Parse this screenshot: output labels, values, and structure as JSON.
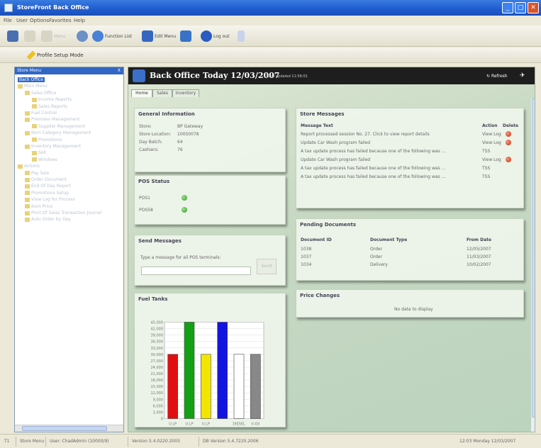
{
  "window": {
    "title": "StoreFront Back Office"
  },
  "menu": [
    "File",
    "User",
    "Options",
    "Favorites",
    "Help"
  ],
  "toolbar": {
    "buttons": [
      "Back",
      "Forward",
      "Menu",
      "Function List",
      "Edit Menu",
      "",
      "Log out",
      ""
    ]
  },
  "toolbar2": {
    "mode_label": "Profile Setup Mode"
  },
  "sidebar": {
    "header": "Store Menu",
    "close": "X",
    "items": [
      {
        "label": "Back Office",
        "level": 0,
        "selected": true
      },
      {
        "label": "Main Menu",
        "level": 0
      },
      {
        "label": "Sales Office",
        "level": 1
      },
      {
        "label": "Income Reports",
        "level": 2
      },
      {
        "label": "Sales Reports",
        "level": 2
      },
      {
        "label": "Fuel Control",
        "level": 1
      },
      {
        "label": "Premises Management",
        "level": 1
      },
      {
        "label": "Supplier Management",
        "level": 2
      },
      {
        "label": "Item Category Management",
        "level": 1
      },
      {
        "label": "Promotions",
        "level": 2
      },
      {
        "label": "Inventory Management",
        "level": 1
      },
      {
        "label": "Sell",
        "level": 2
      },
      {
        "label": "Windows",
        "level": 2
      },
      {
        "label": "Actions",
        "level": 0
      },
      {
        "label": "Pay Sale",
        "level": 1
      },
      {
        "label": "Order Document",
        "level": 1
      },
      {
        "label": "End Of Day Report",
        "level": 1
      },
      {
        "label": "Promotions Setup",
        "level": 1
      },
      {
        "label": "View Log for Process",
        "level": 1
      },
      {
        "label": "Item Price",
        "level": 1
      },
      {
        "label": "Print Of Sales Transaction Journal",
        "level": 1
      },
      {
        "label": "Auto Order by Day",
        "level": 1
      }
    ]
  },
  "main": {
    "title": "Back Office Today 12/03/2007",
    "last_updated": "Last updated 11:58:01",
    "refresh": "Refresh",
    "tabs": [
      {
        "label": "Home",
        "active": true
      },
      {
        "label": "Sales",
        "active": false
      },
      {
        "label": "Inventory",
        "active": false
      }
    ]
  },
  "general": {
    "title": "General Information",
    "rows": [
      {
        "label": "Store:",
        "value": "BP Gateway"
      },
      {
        "label": "Store Location:",
        "value": "10050078"
      },
      {
        "label": "Day Batch:",
        "value": "64"
      },
      {
        "label": "Cashiers:",
        "value": "76"
      }
    ]
  },
  "pos": {
    "title": "POS Status",
    "rows": [
      {
        "label": "POS1",
        "status": "online"
      },
      {
        "label": "POS58",
        "status": "online"
      }
    ]
  },
  "send": {
    "title": "Send Messages",
    "prompt": "Type a message for all POS terminals:",
    "value": "",
    "button": "Send"
  },
  "tanks": {
    "title": "Fuel Tanks"
  },
  "chart_data": {
    "type": "bar",
    "categories": [
      "U.LP",
      "U.LP",
      "U.LP",
      "",
      "DIESEL",
      "V-Oil"
    ],
    "values": [
      30000,
      45000,
      30000,
      45000,
      30000,
      30000
    ],
    "colors": [
      "#e01010",
      "#14a014",
      "#f2e600",
      "#1414e0",
      "#ffffff",
      "#888888"
    ],
    "yticks": [
      "45,000",
      "42,000",
      "39,000",
      "36,000",
      "33,000",
      "30,000",
      "27,000",
      "24,000",
      "21,000",
      "18,000",
      "15,000",
      "12,000",
      "9,000",
      "6,000",
      "3,000",
      "0"
    ],
    "ylim": [
      0,
      45000
    ],
    "grid": true
  },
  "store_messages": {
    "title": "Store Messages",
    "headers": [
      "Message Text",
      "Action",
      "Delete"
    ],
    "rows": [
      {
        "text": "Report processed session No. 27. Click to view report details",
        "action": "View Log",
        "delete": true
      },
      {
        "text": "Update Car Wash program failed",
        "action": "View Log",
        "delete": true
      },
      {
        "text": "A tax update process has failed because one of the following was ...",
        "action": "TSS",
        "delete": false
      },
      {
        "text": "Update Car Wash program failed",
        "action": "View Log",
        "delete": true
      },
      {
        "text": "A tax update process has failed because one of the following was ...",
        "action": "TSS",
        "delete": false
      },
      {
        "text": "A tax update process has failed because one of the following was ...",
        "action": "TSS",
        "delete": false
      }
    ]
  },
  "pending": {
    "title": "Pending Documents",
    "headers": [
      "Document ID",
      "Document Type",
      "From Date"
    ],
    "rows": [
      {
        "id": "1038",
        "type": "Order",
        "date": "12/05/2007"
      },
      {
        "id": "1037",
        "type": "Order",
        "date": "11/03/2007"
      },
      {
        "id": "1034",
        "type": "Delivery",
        "date": "10/02/2007"
      }
    ]
  },
  "price": {
    "title": "Price Changes",
    "empty": "No data to display"
  },
  "statusbar": {
    "item1": "T1",
    "item2": "Store Menu",
    "item3": "User: ChadAdmin (10000/9)",
    "item4": "Version 5.4.0220.2003",
    "item5": "DB Version 5.4.7220.2006",
    "item6": "12:03 Monday 12/03/2007"
  }
}
